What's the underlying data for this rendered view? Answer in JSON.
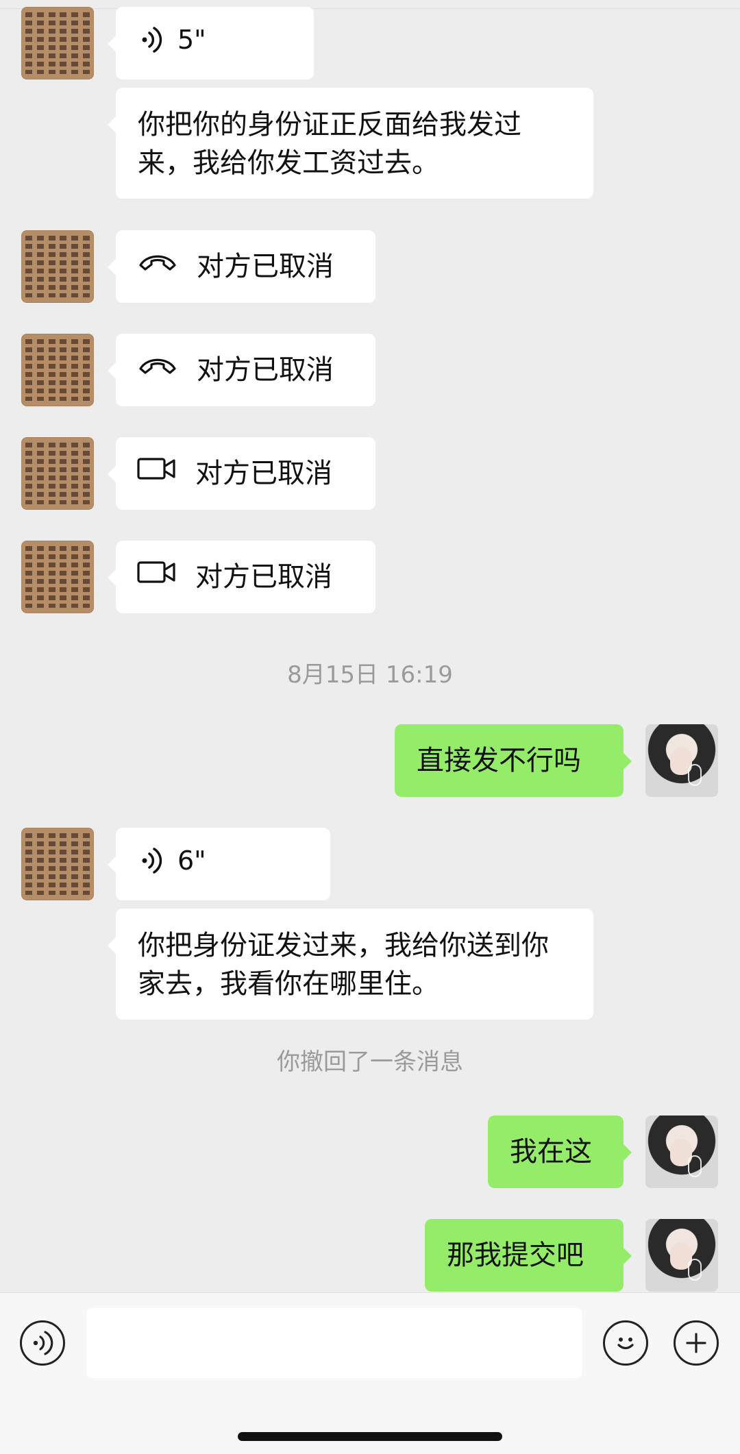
{
  "messages": [
    {
      "type": "voice",
      "duration": "5\""
    },
    {
      "type": "text",
      "text": "你把你的身份证正反面给我发过来，我给你发工资过去。"
    },
    {
      "type": "call",
      "icon": "phone-icon",
      "label": "对方已取消"
    },
    {
      "type": "call",
      "icon": "phone-icon",
      "label": "对方已取消"
    },
    {
      "type": "call",
      "icon": "video-icon",
      "label": "对方已取消"
    },
    {
      "type": "call",
      "icon": "video-icon",
      "label": "对方已取消"
    },
    {
      "type": "timestamp",
      "text": "8月15日 16:19"
    },
    {
      "type": "text",
      "text": "直接发不行吗"
    },
    {
      "type": "voice",
      "duration": "6\""
    },
    {
      "type": "text",
      "text": "你把身份证发过来，我给你送到你家去，我看你在哪里住。"
    },
    {
      "type": "system",
      "text": "你撤回了一条消息"
    },
    {
      "type": "text",
      "text": "我在这"
    },
    {
      "type": "text",
      "text": "那我提交吧"
    }
  ],
  "composer": {
    "left_button": "voice-input-icon",
    "right_buttons": [
      "emoji-icon",
      "plus-icon"
    ]
  },
  "colors": {
    "background": "#ededed",
    "self_bubble": "#95ec69",
    "other_bubble": "#ffffff",
    "muted_text": "#9a9a9a"
  }
}
